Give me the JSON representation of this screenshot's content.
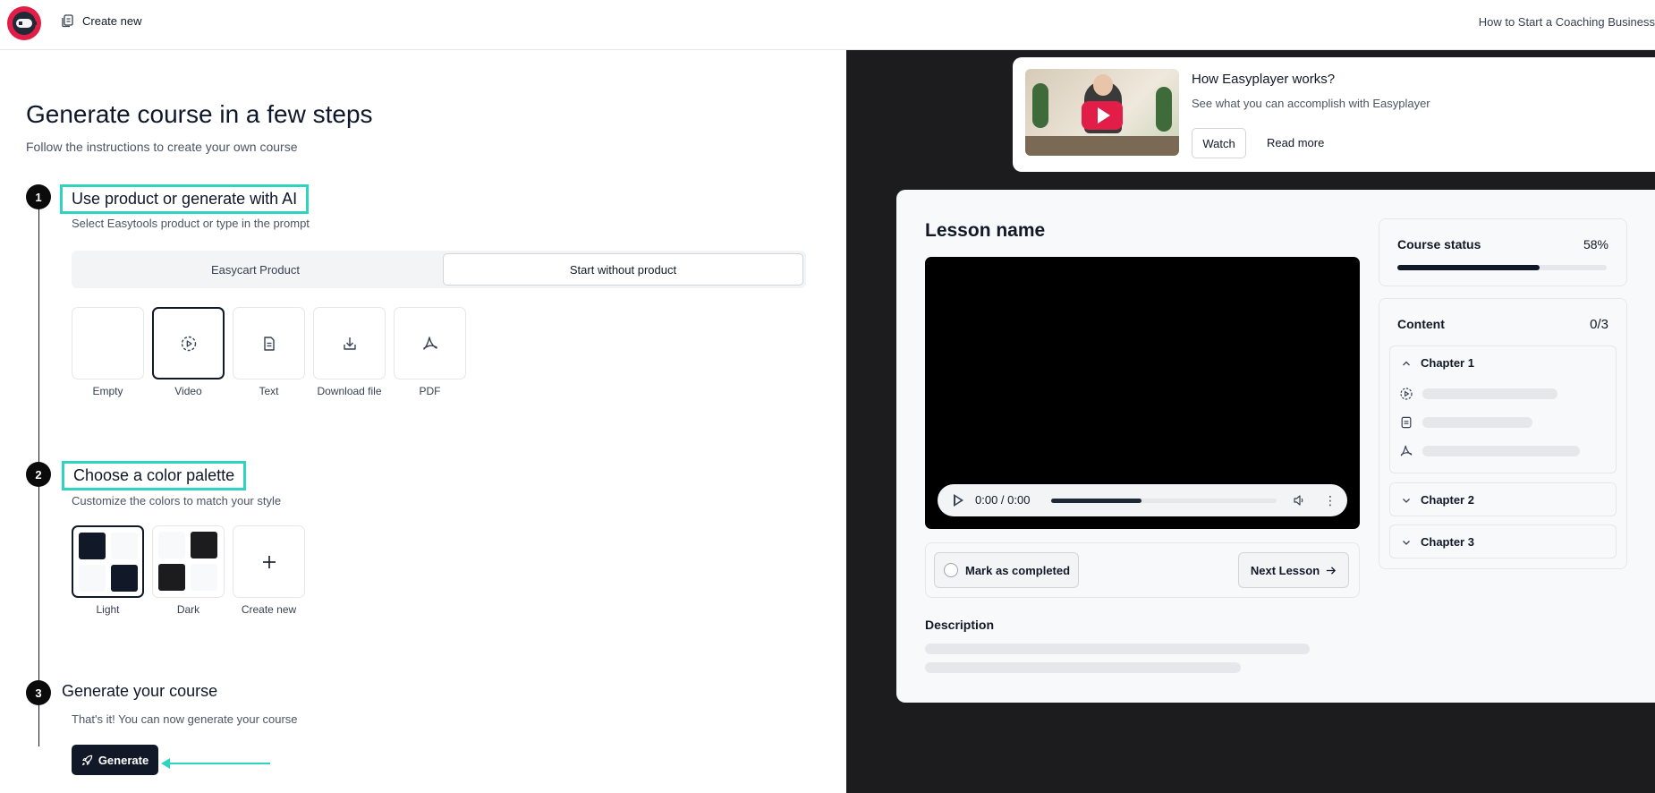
{
  "topbar": {
    "create_new_label": "Create new",
    "course_title": "How to Start a Coaching Business"
  },
  "page": {
    "title": "Generate course in a few steps",
    "subtitle": "Follow the instructions to create your own course"
  },
  "steps": [
    {
      "number": "1",
      "title": "Use product or generate with AI",
      "subtitle": "Select Easytools product or type in the prompt"
    },
    {
      "number": "2",
      "title": "Choose a color palette",
      "subtitle": "Customize the colors to match your style"
    },
    {
      "number": "3",
      "title": "Generate your course",
      "subtitle": "That's it! You can now generate your course"
    }
  ],
  "source_toggle": {
    "option_product": "Easycart Product",
    "option_no_product": "Start without product",
    "selected": "Start without product"
  },
  "lesson_types": [
    {
      "label": "Empty",
      "icon": "none"
    },
    {
      "label": "Video",
      "icon": "video-icon",
      "selected": true
    },
    {
      "label": "Text",
      "icon": "text-icon"
    },
    {
      "label": "Download file",
      "icon": "download-icon"
    },
    {
      "label": "PDF",
      "icon": "pdf-icon"
    }
  ],
  "palettes": [
    {
      "label": "Light",
      "selected": true,
      "dark": "#111827",
      "light": "#f8f9fa"
    },
    {
      "label": "Dark",
      "dark": "#1c1c1e",
      "light": "#f8f9fa"
    },
    {
      "label": "Create new",
      "icon": "plus-icon"
    }
  ],
  "generate_button": {
    "label": "Generate",
    "icon": "rocket-icon"
  },
  "how_card": {
    "title": "How Easyplayer works?",
    "subtitle": "See what you can accomplish with Easyplayer",
    "watch_label": "Watch",
    "read_more_label": "Read more"
  },
  "preview": {
    "lesson_name": "Lesson name",
    "player": {
      "time": "0:00 / 0:00",
      "progress": 0.4
    },
    "mark_completed_label": "Mark as completed",
    "next_lesson_label": "Next Lesson",
    "description_title": "Description",
    "course_status": {
      "label": "Course status",
      "percent_text": "58%",
      "progress": 0.68
    },
    "content": {
      "label": "Content",
      "count": "0/3",
      "chapters": [
        {
          "title": "Chapter 1",
          "expanded": true,
          "lessons": [
            "video-icon",
            "text-icon",
            "pdf-icon"
          ]
        },
        {
          "title": "Chapter 2",
          "expanded": false
        },
        {
          "title": "Chapter 3",
          "expanded": false
        }
      ]
    }
  },
  "colors": {
    "accent": "#2dd4bf",
    "dark": "#111827",
    "brand": "#e11d48"
  }
}
